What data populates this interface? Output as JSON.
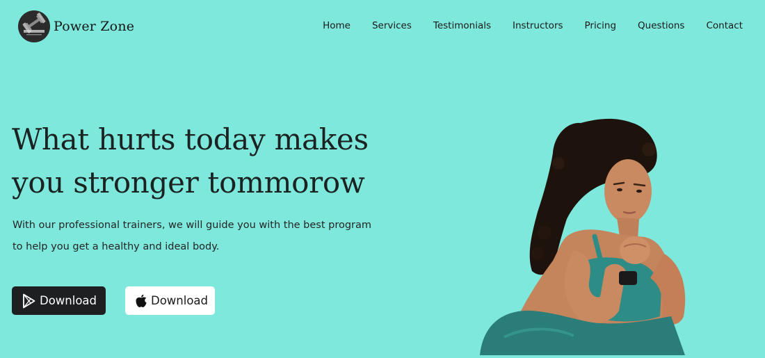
{
  "brand": {
    "name": "Power Zone",
    "logo_icon": "dumbbell-icon"
  },
  "nav": {
    "items": [
      "Home",
      "Services",
      "Testimonials",
      "Instructors",
      "Pricing",
      "Questions",
      "Contact"
    ]
  },
  "hero": {
    "title": "What hurts today makes you stronger tommorow",
    "subtitle": "With our professional trainers, we will guide you with the best program to help you get a healthy and ideal body.",
    "buttons": [
      {
        "label": "Download",
        "icon": "google-play-icon",
        "style": "dark"
      },
      {
        "label": "Download",
        "icon": "apple-icon",
        "style": "light"
      }
    ]
  },
  "colors": {
    "background": "#7ee8dc",
    "dark_button": "#1d1f20",
    "light_button": "#ffffff",
    "outfit": "#2e8c86",
    "skin": "#c98a62",
    "hair": "#1e120c"
  }
}
